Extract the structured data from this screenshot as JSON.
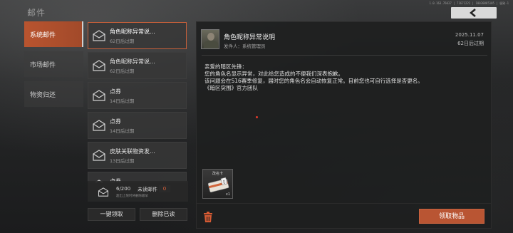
{
  "header": {
    "title": "邮件",
    "build_info": "1.0.163.76037 | 71671222 | 10030865105 | 极致-1",
    "back_icon": "chevron-left-icon"
  },
  "categories": [
    {
      "label": "系统邮件",
      "active": true
    },
    {
      "label": "市场邮件",
      "active": false
    },
    {
      "label": "物资归还",
      "active": false
    }
  ],
  "mail_list": [
    {
      "title": "角色昵称异常说...",
      "expire": "62日后过期",
      "active": true
    },
    {
      "title": "角色昵称异常说...",
      "expire": "62日后过期",
      "active": false
    },
    {
      "title": "点券",
      "expire": "14日后过期",
      "active": false
    },
    {
      "title": "点券",
      "expire": "14日后过期",
      "active": false
    },
    {
      "title": "皮肤关联物资发...",
      "expire": "13日后过期",
      "active": false
    },
    {
      "title": "点券",
      "expire": "",
      "active": false
    }
  ],
  "status": {
    "count": "6/200",
    "unread_label": "未读邮件",
    "unread_count": "0",
    "note": "超出上限时将删除最早"
  },
  "actions": {
    "claim_all": "一键领取",
    "delete_read": "删除已读",
    "claim_items": "领取物品"
  },
  "detail": {
    "title": "角色昵称异常说明",
    "sender": "发件人：系统管理员",
    "date": "2025.11.07",
    "expire": "62日后过期",
    "body": [
      "亲爱的暗区先锋：",
      "您的角色名显示异常，对此给您造成的不便我们深表抱歉。",
      "该问题会在S16赛季修复，届时您的角色名会自动恢复正常。目前您也可自行选择是否更名。",
      "《暗区突围》官方团队"
    ],
    "attachment": {
      "name": "改名卡",
      "quantity": "x1"
    }
  }
}
